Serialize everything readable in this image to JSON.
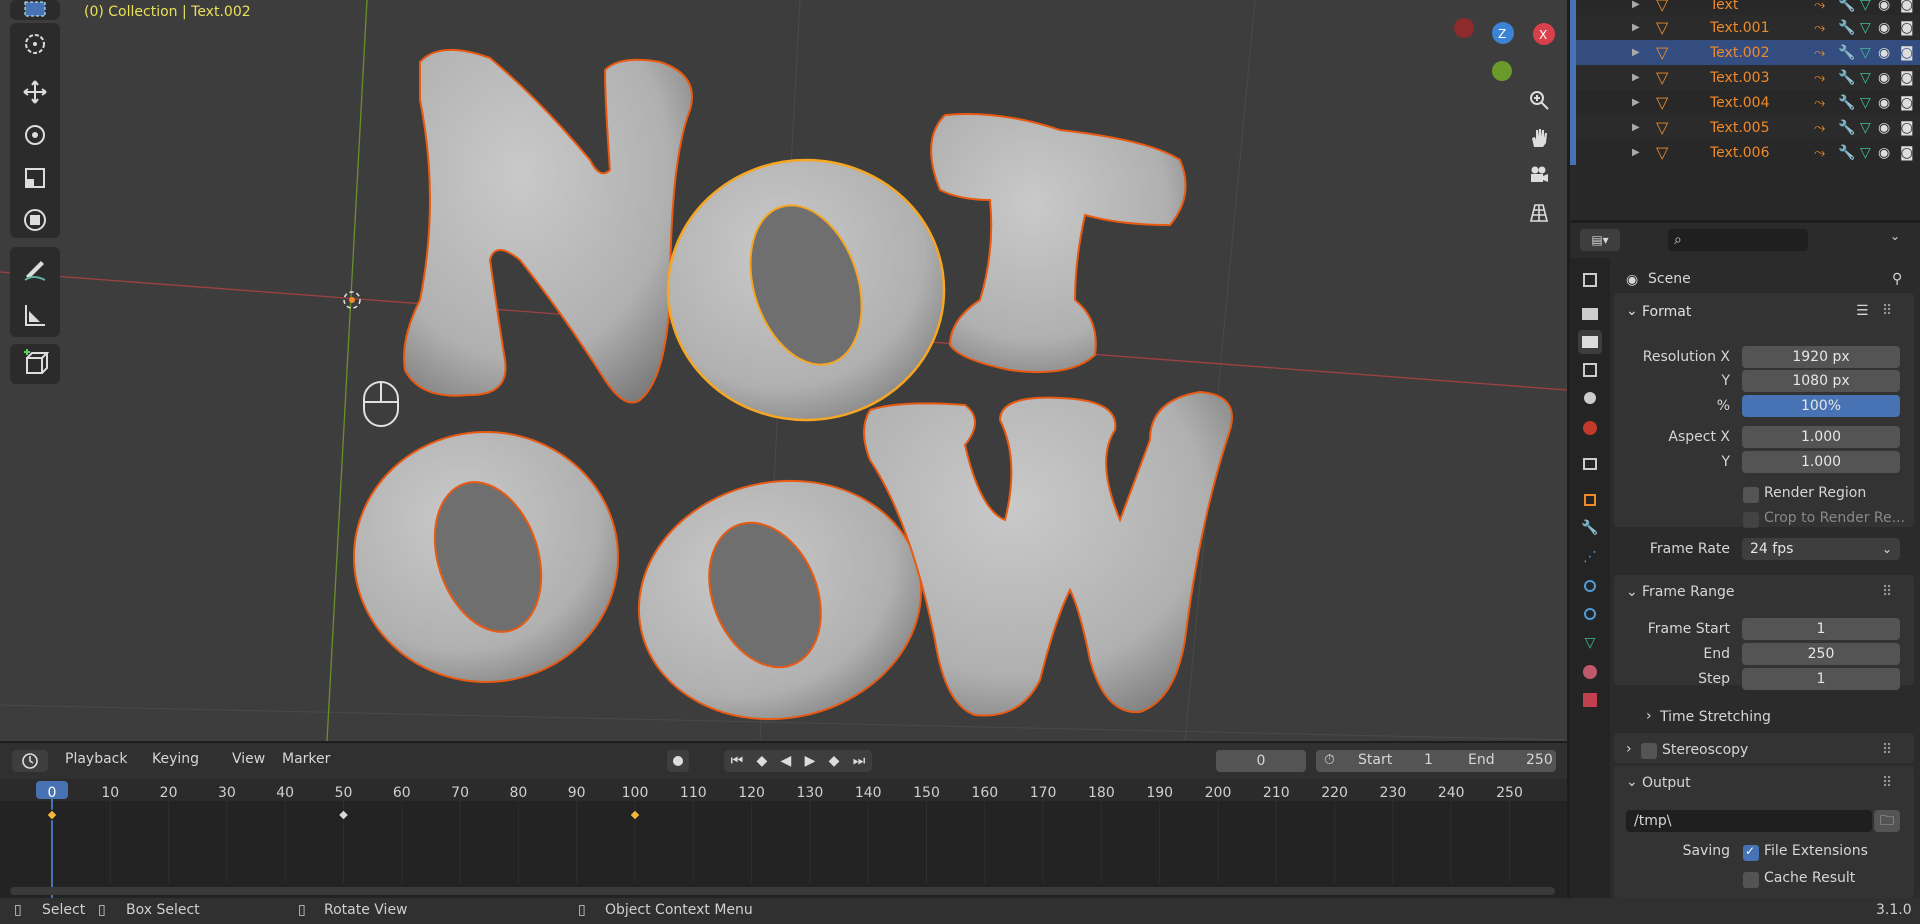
{
  "viewport": {
    "title": "(0) Collection | Text.002",
    "axis_gizmo": {
      "z_label": "Z",
      "x_label": "X"
    },
    "tools": [
      "select-box-icon",
      "cursor-icon",
      "move-icon",
      "rotate-icon",
      "scale-icon",
      "transform-icon",
      "annotate-icon",
      "measure-icon",
      "add-cube-icon"
    ]
  },
  "timeline": {
    "editor_menu_icon": "clock-icon",
    "menus": [
      "Playback",
      "Keying",
      "View",
      "Marker"
    ],
    "current_frame": "0",
    "start_label": "Start",
    "start_value": "1",
    "end_label": "End",
    "end_value": "250",
    "ruler": [
      "0",
      "10",
      "20",
      "30",
      "40",
      "50",
      "60",
      "70",
      "80",
      "90",
      "100",
      "110",
      "120",
      "130",
      "140",
      "150",
      "160",
      "170",
      "180",
      "190",
      "200",
      "210",
      "220",
      "230",
      "240",
      "250"
    ],
    "keyframes": [
      0,
      50,
      100
    ]
  },
  "outliner": {
    "rows": [
      {
        "name": "Text",
        "selected": false
      },
      {
        "name": "Text.001",
        "selected": false
      },
      {
        "name": "Text.002",
        "selected": true
      },
      {
        "name": "Text.003",
        "selected": false
      },
      {
        "name": "Text.004",
        "selected": false
      },
      {
        "name": "Text.005",
        "selected": false
      },
      {
        "name": "Text.006",
        "selected": false
      }
    ]
  },
  "properties": {
    "context": "Scene",
    "format": {
      "title": "Format",
      "res_x_label": "Resolution X",
      "res_x": "1920 px",
      "res_y_label": "Y",
      "res_y": "1080 px",
      "pct_label": "%",
      "pct": "100%",
      "aspect_x_label": "Aspect X",
      "aspect_x": "1.000",
      "aspect_y_label": "Y",
      "aspect_y": "1.000",
      "render_region": "Render Region",
      "crop": "Crop to Render Re...",
      "frame_rate_label": "Frame Rate",
      "frame_rate": "24 fps"
    },
    "frame_range": {
      "title": "Frame Range",
      "start_label": "Frame Start",
      "start": "1",
      "end_label": "End",
      "end": "250",
      "step_label": "Step",
      "step": "1"
    },
    "time_stretching": "Time Stretching",
    "stereoscopy": "Stereoscopy",
    "output": {
      "title": "Output",
      "path": "/tmp\\",
      "saving_label": "Saving",
      "file_ext": "File Extensions",
      "cache": "Cache Result"
    }
  },
  "statusbar": {
    "select": "Select",
    "box_select": "Box Select",
    "rotate": "Rotate View",
    "context_menu": "Object Context Menu",
    "version": "3.1.0"
  },
  "colors": {
    "selection_outline": "#e85a12",
    "active_outline": "#f5a623",
    "object_orange": "#f08a2a",
    "accent_blue": "#4772b3"
  }
}
